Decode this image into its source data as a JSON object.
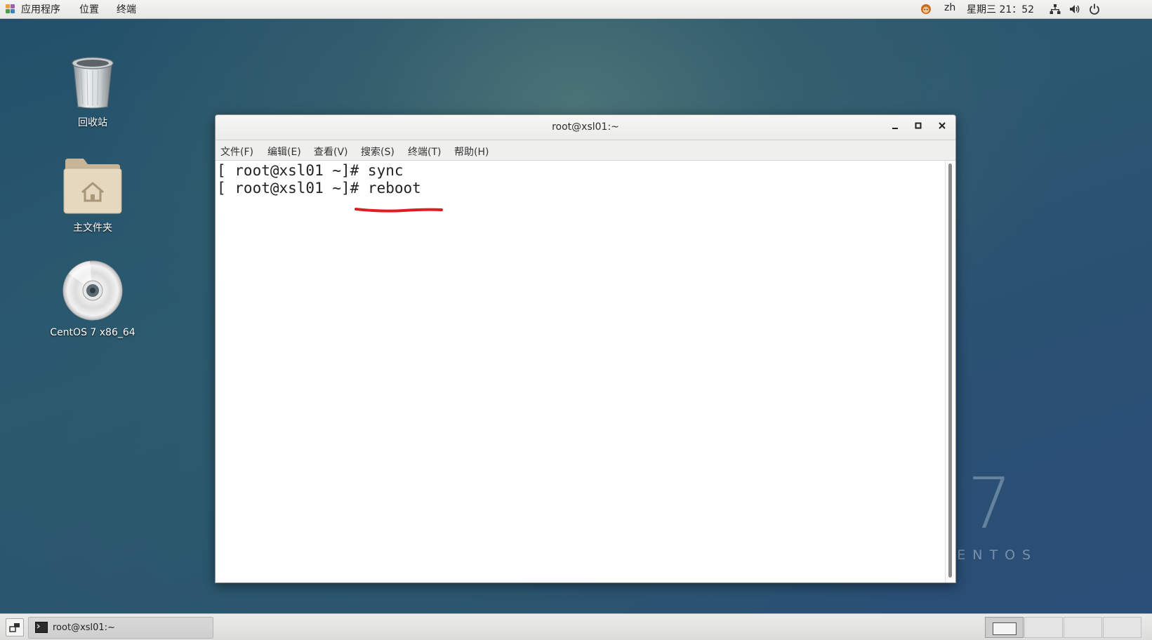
{
  "topbar": {
    "menu": [
      "应用程序",
      "位置",
      "终端"
    ],
    "lang": "zh",
    "datetime": "星期三 21：52",
    "icons": [
      "fox-indicator-icon",
      "network-icon",
      "volume-icon",
      "power-icon"
    ]
  },
  "desktop": {
    "icons": [
      {
        "label": "回收站",
        "icon": "trash-icon"
      },
      {
        "label": "主文件夹",
        "icon": "home-folder-icon"
      },
      {
        "label": "CentOS 7 x86_64",
        "icon": "disc-icon"
      }
    ],
    "watermark": {
      "number": "7",
      "text": "CENTOS"
    }
  },
  "terminal": {
    "title": "root@xsl01:~",
    "menu": [
      "文件(F)",
      "编辑(E)",
      "查看(V)",
      "搜索(S)",
      "终端(T)",
      "帮助(H)"
    ],
    "lines": [
      "[ root@xsl01 ~]# sync",
      "[ root@xsl01 ~]# reboot"
    ],
    "annotation_color": "#e01b24"
  },
  "taskbar": {
    "task_label": "root@xsl01:~",
    "workspaces": 4
  }
}
